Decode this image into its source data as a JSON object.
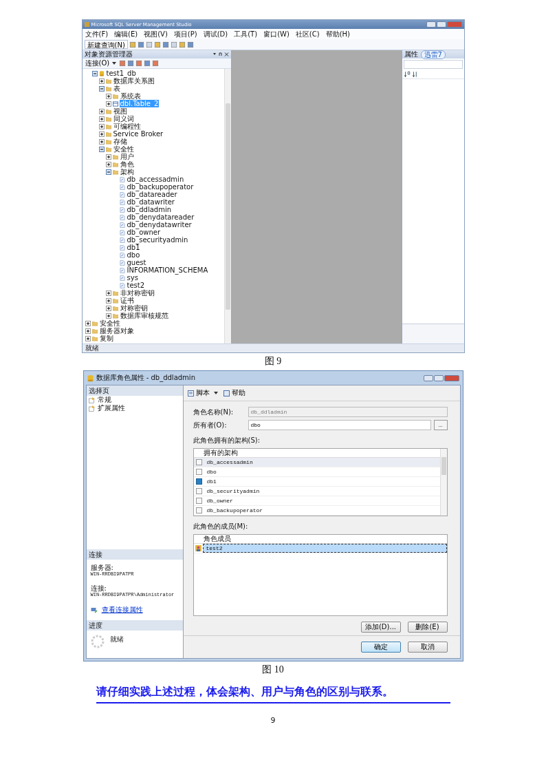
{
  "ssms": {
    "title": "Microsoft SQL Server Management Studio",
    "menu": [
      "文件(F)",
      "编辑(E)",
      "视图(V)",
      "项目(P)",
      "调试(D)",
      "工具(T)",
      "窗口(W)",
      "社区(C)",
      "帮助(H)"
    ],
    "new_query": "新建查询(N)",
    "explorer": {
      "title": "对象资源管理器",
      "connect": "连接(O)",
      "tree": [
        {
          "label": "test1_db",
          "kind": "database",
          "expanded": true,
          "selected": false,
          "children": [
            {
              "label": "数据库关系图",
              "kind": "folder",
              "expanded": false,
              "selected": false
            },
            {
              "label": "表",
              "kind": "folder",
              "expanded": true,
              "selected": false,
              "children": [
                {
                  "label": "系统表",
                  "kind": "folder",
                  "expanded": false,
                  "selected": false
                },
                {
                  "label": "dbl.Table_2",
                  "kind": "table",
                  "expanded": false,
                  "selected": true
                }
              ]
            },
            {
              "label": "视图",
              "kind": "folder",
              "expanded": false,
              "selected": false
            },
            {
              "label": "同义词",
              "kind": "folder",
              "expanded": false,
              "selected": false
            },
            {
              "label": "可编程性",
              "kind": "folder",
              "expanded": false,
              "selected": false
            },
            {
              "label": "Service Broker",
              "kind": "folder",
              "expanded": false,
              "selected": false
            },
            {
              "label": "存储",
              "kind": "folder",
              "expanded": false,
              "selected": false
            },
            {
              "label": "安全性",
              "kind": "folder",
              "expanded": true,
              "selected": false,
              "children": [
                {
                  "label": "用户",
                  "kind": "folder",
                  "expanded": false,
                  "selected": false
                },
                {
                  "label": "角色",
                  "kind": "folder",
                  "expanded": false,
                  "selected": false
                },
                {
                  "label": "架构",
                  "kind": "folder",
                  "expanded": true,
                  "selected": false,
                  "children": [
                    {
                      "label": "db_accessadmin",
                      "kind": "schema",
                      "selected": false
                    },
                    {
                      "label": "db_backupoperator",
                      "kind": "schema",
                      "selected": false
                    },
                    {
                      "label": "db_datareader",
                      "kind": "schema",
                      "selected": false
                    },
                    {
                      "label": "db_datawriter",
                      "kind": "schema",
                      "selected": false
                    },
                    {
                      "label": "db_ddladmin",
                      "kind": "schema",
                      "selected": false
                    },
                    {
                      "label": "db_denydatareader",
                      "kind": "schema",
                      "selected": false
                    },
                    {
                      "label": "db_denydatawriter",
                      "kind": "schema",
                      "selected": false
                    },
                    {
                      "label": "db_owner",
                      "kind": "schema",
                      "selected": false
                    },
                    {
                      "label": "db_securityadmin",
                      "kind": "schema",
                      "selected": false
                    },
                    {
                      "label": "db1",
                      "kind": "schema",
                      "selected": false
                    },
                    {
                      "label": "dbo",
                      "kind": "schema",
                      "selected": false
                    },
                    {
                      "label": "guest",
                      "kind": "schema",
                      "selected": false
                    },
                    {
                      "label": "INFORMATION_SCHEMA",
                      "kind": "schema",
                      "selected": false
                    },
                    {
                      "label": "sys",
                      "kind": "schema",
                      "selected": false
                    },
                    {
                      "label": "test2",
                      "kind": "schema",
                      "selected": false
                    }
                  ]
                },
                {
                  "label": "非对称密钥",
                  "kind": "folder",
                  "expanded": false,
                  "selected": false
                },
                {
                  "label": "证书",
                  "kind": "folder",
                  "expanded": false,
                  "selected": false
                },
                {
                  "label": "对称密钥",
                  "kind": "folder",
                  "expanded": false,
                  "selected": false
                },
                {
                  "label": "数据库审核规范",
                  "kind": "folder",
                  "expanded": false,
                  "selected": false
                }
              ]
            }
          ]
        }
      ],
      "server_nodes": [
        {
          "label": "安全性",
          "kind": "folder",
          "expanded": false,
          "selected": false
        },
        {
          "label": "服务器对象",
          "kind": "folder",
          "expanded": false,
          "selected": false
        },
        {
          "label": "复制",
          "kind": "folder",
          "expanded": false,
          "selected": false
        }
      ]
    },
    "properties": {
      "title": "属性"
    },
    "overlay_badge": "迅雷7",
    "status": "就绪"
  },
  "caption_1": "图 9",
  "dialog": {
    "title": "数据库角色属性 - db_ddladmin",
    "pages_header": "选择页",
    "pages": [
      "常规",
      "扩展属性"
    ],
    "connection_header": "连接",
    "server_label": "服务器:",
    "server": "WIN-RRDBI9PATPR",
    "connection_label": "连接:",
    "connection": "WIN-RRDBI9PATPR\\Administrator",
    "link": "查看连接属性",
    "progress_header": "进度",
    "progress_status": "就绪",
    "script_button": "脚本",
    "help_button": "帮助",
    "role_name_label": "角色名称(N):",
    "role_name": "db_ddladmin",
    "owner_label": "所有者(O):",
    "owner": "dbo",
    "browse": "...",
    "schemas_label": "此角色拥有的架构(S):",
    "schemas_header": "拥有的架构",
    "schemas": [
      {
        "name": "db_accessadmin",
        "checked": false,
        "selected": true
      },
      {
        "name": "dbo",
        "checked": false,
        "selected": false
      },
      {
        "name": "db1",
        "checked": true,
        "selected": false
      },
      {
        "name": "db_securityadmin",
        "checked": false,
        "selected": false
      },
      {
        "name": "db_owner",
        "checked": false,
        "selected": false
      },
      {
        "name": "db_backupoperator",
        "checked": false,
        "selected": false
      }
    ],
    "members_label": "此角色的成员(M):",
    "members_header": "角色成员",
    "members": [
      {
        "name": "test2",
        "selected": true
      }
    ],
    "add": "添加(D)...",
    "remove": "删除(E)",
    "ok": "确定",
    "cancel": "取消"
  },
  "caption_2": "图 10",
  "note": "请仔细实践上述过程，体会架构、用户与角色的区别与联系。",
  "page_number": "9"
}
